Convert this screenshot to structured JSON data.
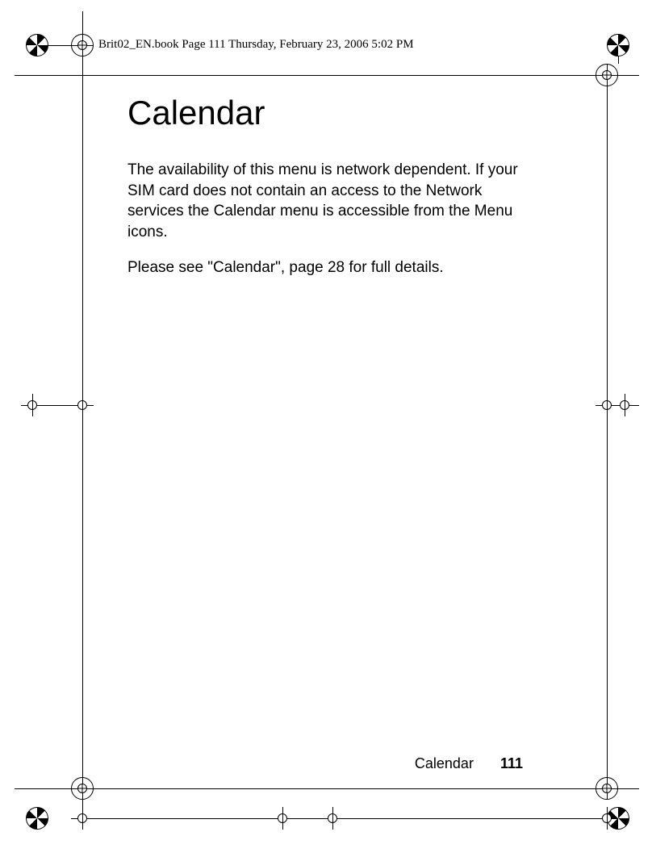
{
  "header": {
    "meta": "Brit02_EN.book  Page 111  Thursday, February 23, 2006  5:02 PM"
  },
  "body": {
    "title": "Calendar",
    "para1": "The availability of this menu is network dependent. If your SIM card does not contain an access to the Network services the Calendar menu is accessible from the Menu icons.",
    "para2": "Please see \"Calendar\", page 28 for full details."
  },
  "footer": {
    "section": "Calendar",
    "page": "111"
  }
}
